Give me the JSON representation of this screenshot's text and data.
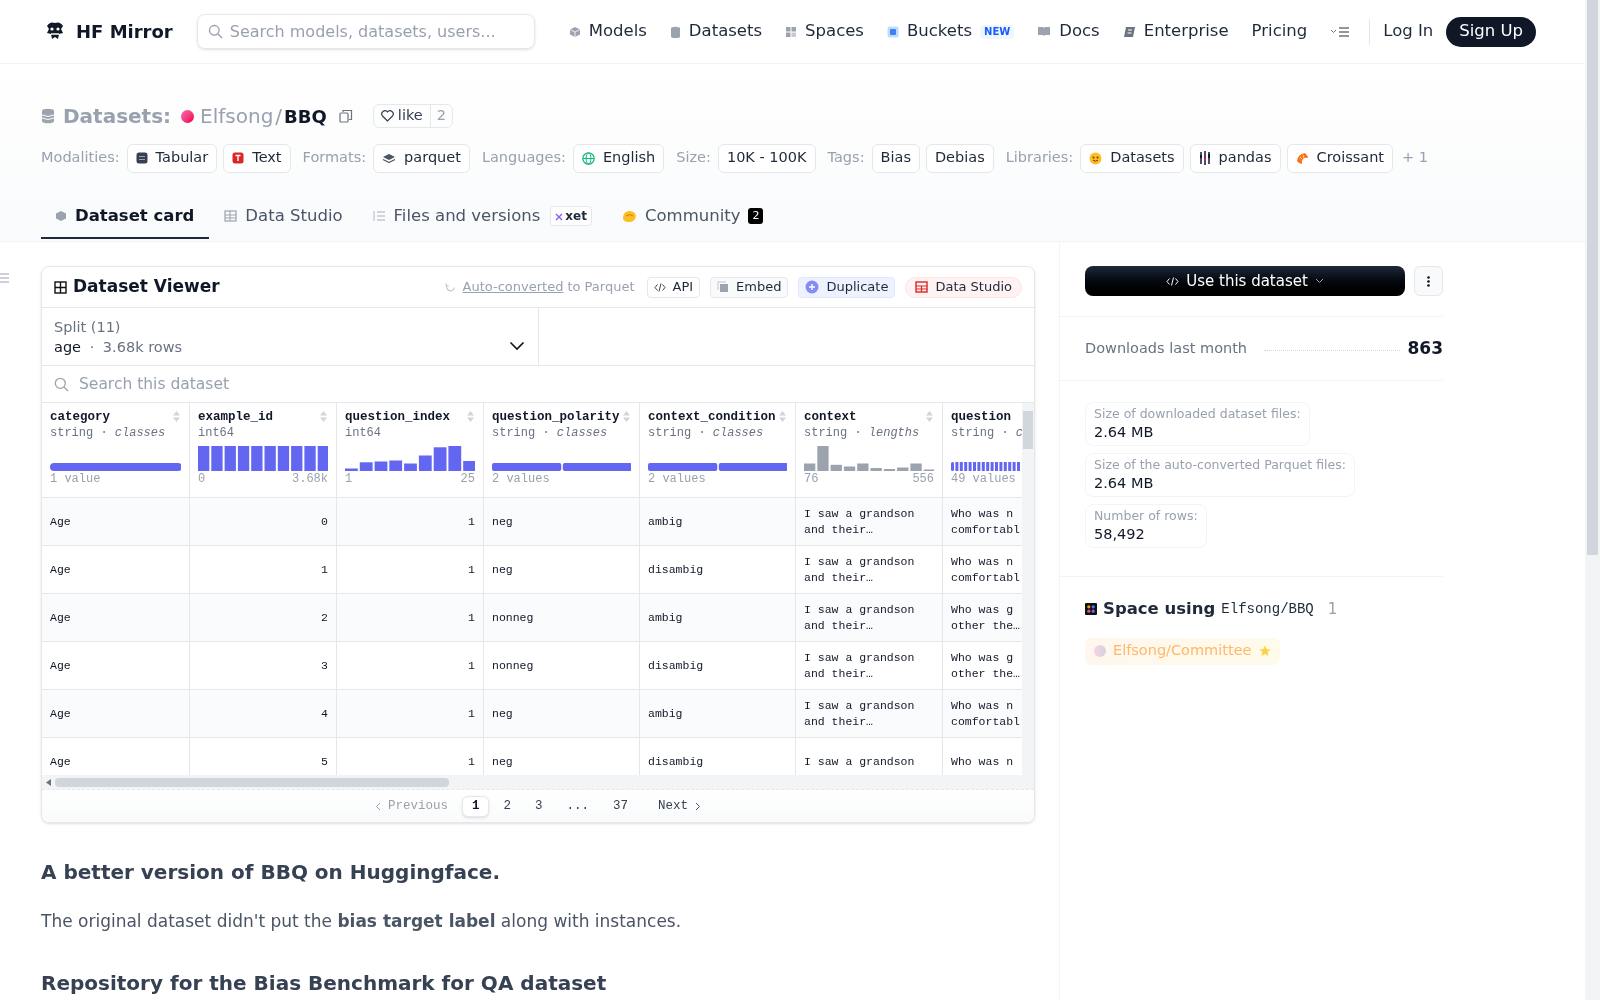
{
  "header": {
    "brand": "HF Mirror",
    "search": {
      "placeholder": "Search models, datasets, users..."
    },
    "nav": [
      {
        "label": "Models"
      },
      {
        "label": "Datasets"
      },
      {
        "label": "Spaces"
      },
      {
        "label": "Buckets",
        "badge": "NEW"
      },
      {
        "label": "Docs"
      },
      {
        "label": "Enterprise"
      },
      {
        "label": "Pricing"
      }
    ],
    "login": "Log In",
    "signup": "Sign Up"
  },
  "repo": {
    "section": "Datasets:",
    "owner": "Elfsong",
    "slash": "/",
    "name": "BBQ",
    "like": "like",
    "likes": "2"
  },
  "tag_groups": [
    {
      "label": "Modalities:",
      "tags": [
        "Tabular",
        "Text"
      ]
    },
    {
      "label": "Formats:",
      "tags": [
        "parquet"
      ]
    },
    {
      "label": "Languages:",
      "tags": [
        "English"
      ]
    },
    {
      "label": "Size:",
      "tags": [
        "10K - 100K"
      ]
    },
    {
      "label": "Tags:",
      "tags": [
        "Bias",
        "Debias"
      ]
    },
    {
      "label": "Libraries:",
      "tags": [
        "Datasets",
        "pandas",
        "Croissant"
      ]
    }
  ],
  "more_tags": "+ 1",
  "tabs": [
    {
      "label": "Dataset card",
      "selected": true
    },
    {
      "label": "Data Studio",
      "selected": false
    },
    {
      "label": "Files and versions",
      "badge": "xet",
      "selected": false
    },
    {
      "label": "Community",
      "count": "2",
      "selected": false
    }
  ],
  "viewer": {
    "title": "Dataset Viewer",
    "converted_link": "Auto-converted",
    "converted_text": "to Parquet",
    "actions": [
      "API",
      "Embed",
      "Duplicate",
      "Data Studio"
    ],
    "split": {
      "label": "Split (11)",
      "name": "age",
      "sep": "·",
      "rows": "3.68k rows"
    },
    "search": {
      "placeholder": "Search this dataset"
    },
    "columns": [
      {
        "name": "category",
        "type": "string · *classes*",
        "kind": "classes",
        "min": "1 value"
      },
      {
        "name": "example_id",
        "type": "int64",
        "kind": "histogram",
        "min": "0",
        "max": "3.68k"
      },
      {
        "name": "question_index",
        "type": "int64",
        "kind": "histogram",
        "min": "1",
        "max": "25"
      },
      {
        "name": "question_polarity",
        "type": "string · *classes*",
        "kind": "classes",
        "min": "2 values"
      },
      {
        "name": "context_condition",
        "type": "string · *classes*",
        "kind": "classes",
        "min": "2 values"
      },
      {
        "name": "context",
        "type": "string · *lengths*",
        "kind": "lengths",
        "min": "76",
        "max": "556"
      },
      {
        "name": "question",
        "type": "string · *c*",
        "kind": "classes",
        "min": "49 values"
      }
    ],
    "rows": [
      [
        "Age",
        "0",
        "1",
        "neg",
        "ambig",
        "I saw a grandson and their…",
        "Who was n comfortabl"
      ],
      [
        "Age",
        "1",
        "1",
        "neg",
        "disambig",
        "I saw a grandson and their…",
        "Who was n comfortabl"
      ],
      [
        "Age",
        "2",
        "1",
        "nonneg",
        "ambig",
        "I saw a grandson and their…",
        "Who was g other the…"
      ],
      [
        "Age",
        "3",
        "1",
        "nonneg",
        "disambig",
        "I saw a grandson and their…",
        "Who was g other the…"
      ],
      [
        "Age",
        "4",
        "1",
        "neg",
        "ambig",
        "I saw a grandson and their…",
        "Who was n comfortabl"
      ],
      [
        "Age",
        "5",
        "1",
        "neg",
        "disambig",
        "I saw a grandson",
        "Who was n"
      ]
    ],
    "pagination": [
      {
        "label": "Previous",
        "kind": "prev",
        "selected": false,
        "disabled": true
      },
      {
        "label": "1",
        "kind": "page",
        "selected": true,
        "disabled": false
      },
      {
        "label": "2",
        "kind": "page",
        "selected": false,
        "disabled": false
      },
      {
        "label": "3",
        "kind": "page",
        "selected": false,
        "disabled": false
      },
      {
        "label": "...",
        "kind": "gap",
        "selected": false,
        "disabled": false
      },
      {
        "label": "37",
        "kind": "page",
        "selected": false,
        "disabled": false
      },
      {
        "label": "Next",
        "kind": "next",
        "selected": false,
        "disabled": false
      }
    ]
  },
  "sidebar": {
    "use_button": "Use this dataset",
    "downloads_label": "Downloads last month",
    "downloads": "863",
    "stats": [
      {
        "label": "Size of downloaded dataset files:",
        "value": "2.64 MB"
      },
      {
        "label": "Size of the auto-converted Parquet files:",
        "value": "2.64 MB"
      },
      {
        "label": "Number of rows:",
        "value": "58,492"
      }
    ],
    "spaces_title": "Space using",
    "spaces_repo": "Elfsong/BBQ",
    "spaces_count": "1",
    "spaces": [
      "Elfsong/Committee"
    ]
  },
  "card": {
    "heading": "A better version of BBQ on Huggingface.",
    "paragraph": "The original dataset didn't put the **bias target label** along with instances.",
    "heading2": "Repository for the Bias Benchmark for QA dataset"
  }
}
